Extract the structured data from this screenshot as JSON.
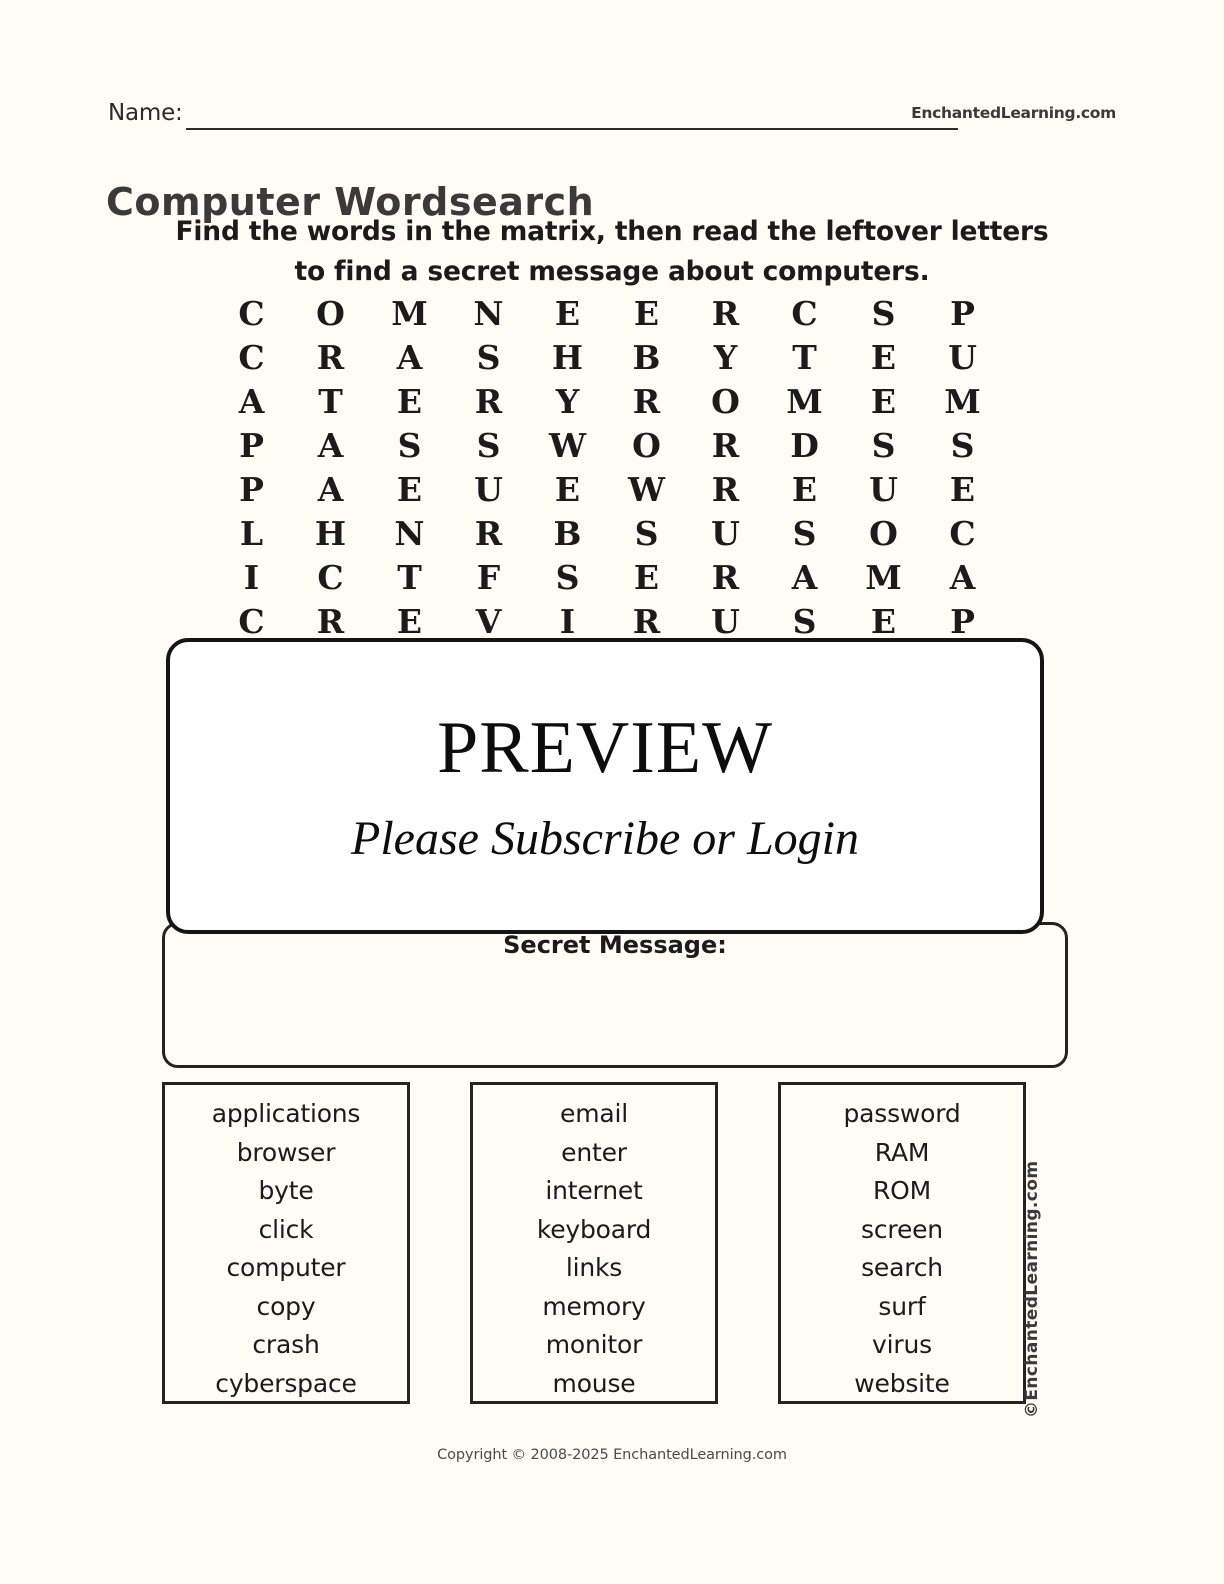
{
  "header": {
    "name_label": "Name:",
    "brand": "EnchantedLearning.com"
  },
  "title": "Computer Wordsearch",
  "instructions": {
    "line1": "Find the words in the matrix, then read the leftover letters",
    "line2": "to find a secret message about computers."
  },
  "grid": {
    "rows": 8,
    "cols": 10,
    "letters": [
      [
        "C",
        "O",
        "M",
        "N",
        "E",
        "E",
        "R",
        "C",
        "S",
        "P"
      ],
      [
        "C",
        "R",
        "A",
        "S",
        "H",
        "B",
        "Y",
        "T",
        "E",
        "U"
      ],
      [
        "A",
        "T",
        "E",
        "R",
        "Y",
        "R",
        "O",
        "M",
        "E",
        "M"
      ],
      [
        "P",
        "A",
        "S",
        "S",
        "W",
        "O",
        "R",
        "D",
        "S",
        "S"
      ],
      [
        "P",
        "A",
        "E",
        "U",
        "E",
        "W",
        "R",
        "E",
        "U",
        "E"
      ],
      [
        "L",
        "H",
        "N",
        "R",
        "B",
        "S",
        "U",
        "S",
        "O",
        "C"
      ],
      [
        "I",
        "C",
        "T",
        "F",
        "S",
        "E",
        "R",
        "A",
        "M",
        "A"
      ],
      [
        "C",
        "R",
        "E",
        "V",
        "I",
        "R",
        "U",
        "S",
        "E",
        "P"
      ]
    ]
  },
  "secret_message": {
    "label": "Secret Message:",
    "value": ""
  },
  "word_lists": [
    {
      "column": 1,
      "words": [
        "applications",
        "browser",
        "byte",
        "click",
        "computer",
        "copy",
        "crash",
        "cyberspace"
      ]
    },
    {
      "column": 2,
      "words": [
        "email",
        "enter",
        "internet",
        "keyboard",
        "links",
        "memory",
        "monitor",
        "mouse"
      ]
    },
    {
      "column": 3,
      "words": [
        "password",
        "RAM",
        "ROM",
        "screen",
        "search",
        "surf",
        "virus",
        "website"
      ]
    }
  ],
  "side_brand": "©EnchantedLearning.com",
  "footer": {
    "copyright": "Copyright © 2008-2025 EnchantedLearning.com"
  },
  "preview_overlay": {
    "title": "PREVIEW",
    "subtitle": "Please Subscribe or Login"
  },
  "colors": {
    "page_background": "#fdfcf5",
    "ink": "#1b1b1b",
    "border": "#232323",
    "overlay_background": "#ffffff"
  }
}
